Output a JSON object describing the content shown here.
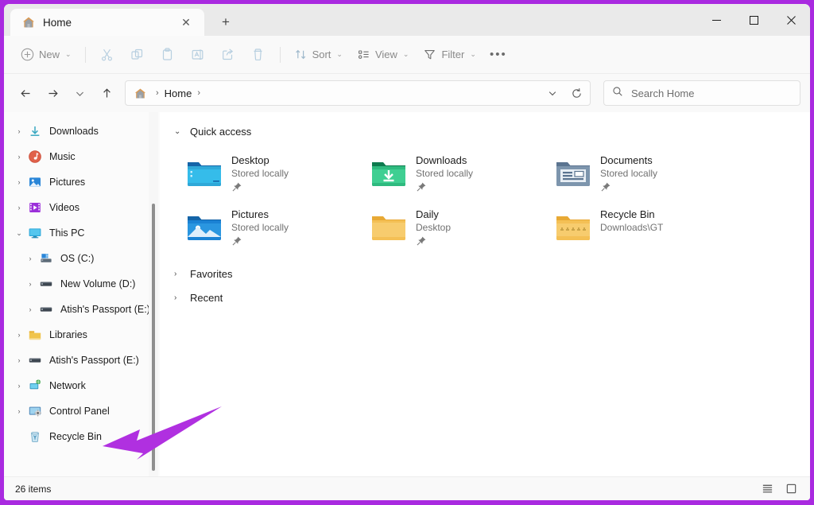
{
  "window": {
    "border_color": "#a92ae0",
    "controls": {
      "minimize": "–",
      "maximize": "☐",
      "close": "✕"
    }
  },
  "tabs": {
    "items": [
      {
        "label": "Home",
        "icon": "home-icon",
        "close": "✕"
      }
    ],
    "new_tab": "+"
  },
  "toolbar": {
    "new_label": "New",
    "chevron": "⌄",
    "buttons": [
      {
        "name": "cut",
        "icon": "scissors-icon"
      },
      {
        "name": "copy",
        "icon": "copy-icon"
      },
      {
        "name": "paste",
        "icon": "clipboard-icon"
      },
      {
        "name": "rename",
        "icon": "rename-icon"
      },
      {
        "name": "share",
        "icon": "share-icon"
      },
      {
        "name": "delete",
        "icon": "trash-icon"
      }
    ],
    "sort_label": "Sort",
    "view_label": "View",
    "filter_label": "Filter",
    "overflow": "•••"
  },
  "navbar": {
    "back": "←",
    "forward": "→",
    "recent": "⌄",
    "up": "↑",
    "breadcrumb": {
      "home_icon": "home-icon",
      "sep": "›",
      "text": "Home",
      "trailing_sep": "›"
    },
    "history_dropdown": "⌄",
    "refresh": "↻"
  },
  "search": {
    "placeholder": "Search Home",
    "value": "",
    "icon": "search-icon"
  },
  "sidebar": {
    "items": [
      {
        "label": "Downloads",
        "icon": "downloads-icon",
        "expand": "›",
        "level": 1,
        "expanded": false
      },
      {
        "label": "Music",
        "icon": "music-icon",
        "expand": "›",
        "level": 1,
        "expanded": false
      },
      {
        "label": "Pictures",
        "icon": "pictures-icon",
        "expand": "›",
        "level": 1,
        "expanded": false
      },
      {
        "label": "Videos",
        "icon": "videos-icon",
        "expand": "›",
        "level": 1,
        "expanded": false
      },
      {
        "label": "This PC",
        "icon": "thispc-icon",
        "expand": "⌄",
        "level": 1,
        "expanded": true
      },
      {
        "label": "OS (C:)",
        "icon": "osdrive-icon",
        "expand": "›",
        "level": 2,
        "expanded": false
      },
      {
        "label": "New Volume (D:)",
        "icon": "drive-icon",
        "expand": "›",
        "level": 2,
        "expanded": false
      },
      {
        "label": "Atish's Passport  (E:)",
        "icon": "drive-icon",
        "expand": "›",
        "level": 2,
        "expanded": false
      },
      {
        "label": "Libraries",
        "icon": "libraries-icon",
        "expand": "›",
        "level": 1,
        "expanded": false
      },
      {
        "label": "Atish's Passport  (E:)",
        "icon": "drive-icon",
        "expand": "›",
        "level": 1,
        "expanded": false
      },
      {
        "label": "Network",
        "icon": "network-icon",
        "expand": "›",
        "level": 1,
        "expanded": false
      },
      {
        "label": "Control Panel",
        "icon": "controlpanel-icon",
        "expand": "›",
        "level": 1,
        "expanded": false
      },
      {
        "label": "Recycle Bin",
        "icon": "recyclebin-icon",
        "expand": "",
        "level": 1,
        "expanded": false
      }
    ]
  },
  "content": {
    "quick_access": {
      "chevron": "⌄",
      "title": "Quick access",
      "tiles": [
        {
          "name": "Desktop",
          "sub": "Stored locally",
          "icon": "desktop-folder-icon",
          "pinned": true
        },
        {
          "name": "Downloads",
          "sub": "Stored locally",
          "icon": "downloads-folder-icon",
          "pinned": true
        },
        {
          "name": "Documents",
          "sub": "Stored locally",
          "icon": "documents-folder-icon",
          "pinned": true
        },
        {
          "name": "Pictures",
          "sub": "Stored locally",
          "icon": "pictures-folder-icon",
          "pinned": true
        },
        {
          "name": "Daily",
          "sub": "Desktop",
          "icon": "plain-folder-icon",
          "pinned": true
        },
        {
          "name": "Recycle Bin",
          "sub": "Downloads\\GT",
          "icon": "recyclebin-folder-icon",
          "pinned": false
        }
      ]
    },
    "favorites": {
      "chevron": "›",
      "title": "Favorites"
    },
    "recent": {
      "chevron": "›",
      "title": "Recent"
    }
  },
  "statusbar": {
    "item_count": "26 items",
    "list_view_icon": "list-view-icon",
    "details_view_icon": "details-view-icon"
  },
  "annotation": {
    "arrow_color": "#b030e0",
    "points_to": "Recycle Bin"
  }
}
